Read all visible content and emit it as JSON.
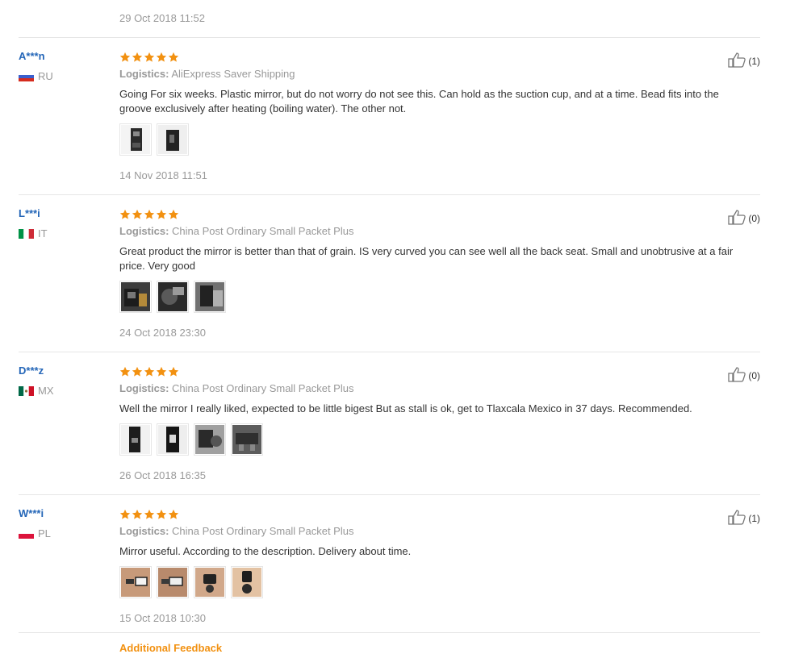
{
  "top_date": "29 Oct 2018 11:52",
  "logistics_label": "Logistics:",
  "reviews": [
    {
      "user": "A***n",
      "country": "RU",
      "stars": 5,
      "logistics": "AliExpress Saver Shipping",
      "text": "Going For six weeks. Plastic mirror, but do not worry do not see this. Can hold as the suction cup, and at a time. Bead fits into the groove exclusively after heating (boiling water). The other not.",
      "helpful": "(1)",
      "date": "14 Nov 2018 11:51"
    },
    {
      "user": "L***i",
      "country": "IT",
      "stars": 5,
      "logistics": "China Post Ordinary Small Packet Plus",
      "text": "Great product the mirror is better than that of grain. IS very curved you can see well all the back seat. Small and unobtrusive at a fair price. Very good",
      "helpful": "(0)",
      "date": "24 Oct 2018 23:30"
    },
    {
      "user": "D***z",
      "country": "MX",
      "stars": 5,
      "logistics": "China Post Ordinary Small Packet Plus",
      "text": "Well the mirror I really liked, expected to be little bigest But as stall is ok, get to Tlaxcala Mexico in 37 days. Recommended.",
      "helpful": "(0)",
      "date": "26 Oct 2018 16:35"
    },
    {
      "user": "W***i",
      "country": "PL",
      "stars": 5,
      "logistics": "China Post Ordinary Small Packet Plus",
      "text": "Mirror useful. According to the description. Delivery about time.",
      "helpful": "(1)",
      "date": "15 Oct 2018 10:30"
    }
  ],
  "additional_feedback": "Additional Feedback",
  "colors": {
    "star": "#f29111",
    "username": "#2466b8",
    "muted": "#999999",
    "link": "#f29111"
  },
  "icons": {
    "star": "star-icon",
    "helpful": "thumbs-up-icon"
  }
}
